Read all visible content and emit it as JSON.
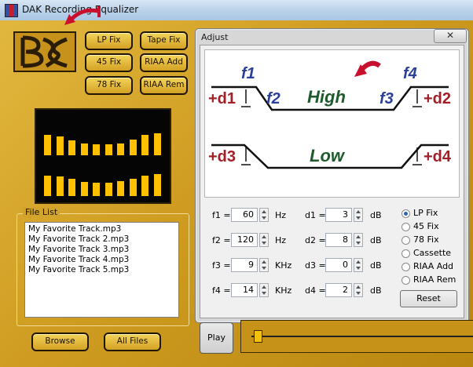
{
  "window": {
    "title": "DAK Recording Equalizer"
  },
  "presets": {
    "lp_fix": "LP Fix",
    "tape_fix": "Tape Fix",
    "fix45": "45 Fix",
    "riaa_add": "RIAA Add",
    "fix78": "78 Fix",
    "riaa_rem": "RIAA Rem"
  },
  "equalizer_levels": [
    0.55,
    0.5,
    0.4,
    0.32,
    0.3,
    0.3,
    0.32,
    0.42,
    0.55,
    0.58,
    0.55,
    0.52,
    0.45,
    0.38,
    0.35,
    0.35,
    0.4,
    0.45,
    0.55,
    0.58
  ],
  "file_list": {
    "label": "File List",
    "items": [
      "My Favorite Track.mp3",
      "My Favorite Track 2.mp3",
      "My Favorite Track 3.mp3",
      "My Favorite Track 4.mp3",
      "My Favorite Track 5.mp3"
    ]
  },
  "buttons": {
    "browse": "Browse",
    "all_files": "All Files",
    "play": "Play",
    "reset": "Reset"
  },
  "adjust": {
    "title": "Adjust",
    "close": "✕",
    "diagram": {
      "f1": "f1",
      "f2": "f2",
      "f3": "f3",
      "f4": "f4",
      "d1": "+d1",
      "d2": "+d2",
      "d3": "+d3",
      "d4": "+d4",
      "high": "High",
      "low": "Low"
    },
    "params": {
      "f1": {
        "label": "f1 =",
        "value": "60",
        "unit": "Hz"
      },
      "f2": {
        "label": "f2 =",
        "value": "120",
        "unit": "Hz"
      },
      "f3": {
        "label": "f3 =",
        "value": "9",
        "unit": "KHz"
      },
      "f4": {
        "label": "f4 =",
        "value": "14",
        "unit": "KHz"
      },
      "d1": {
        "label": "d1 =",
        "value": "3",
        "unit": "dB"
      },
      "d2": {
        "label": "d2 =",
        "value": "8",
        "unit": "dB"
      },
      "d3": {
        "label": "d3 =",
        "value": "0",
        "unit": "dB"
      },
      "d4": {
        "label": "d4 =",
        "value": "2",
        "unit": "dB"
      }
    },
    "radios": [
      "LP Fix",
      "45 Fix",
      "78 Fix",
      "Cassette",
      "RIAA Add",
      "RIAA Rem"
    ],
    "selected_radio": "LP Fix"
  },
  "colors": {
    "gold": "#c99b23",
    "diagram_blue": "#2a3f9a",
    "diagram_red": "#a02028",
    "diagram_green": "#1d5a2c"
  },
  "seek_position": 0.02
}
